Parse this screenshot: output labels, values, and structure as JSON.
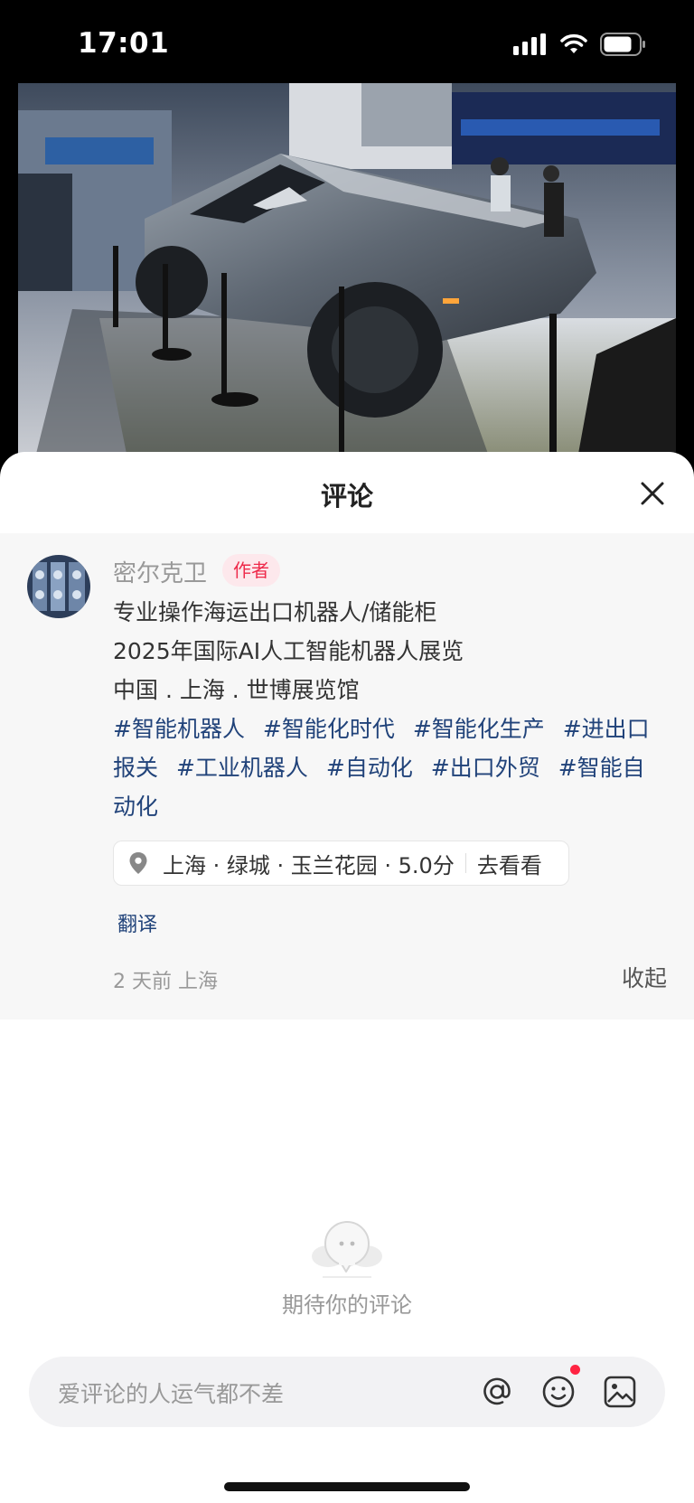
{
  "status_bar": {
    "time": "17:01"
  },
  "sheet": {
    "title": "评论",
    "close_icon": "close-icon"
  },
  "author_post": {
    "author_name": "密尔克卫",
    "author_badge": "作者",
    "lines": [
      "专业操作海运出口机器人/储能柜",
      "2025年国际AI人工智能机器人展览",
      "中国 . 上海 . 世博展览馆"
    ],
    "hashtags": [
      "#智能机器人",
      "#智能化时代",
      "#智能化生产",
      "#进出口报关",
      "#工业机器人",
      "#自动化",
      "#出口外贸",
      "#智能自动化"
    ],
    "location": "上海 · 绿城 · 玉兰花园 · 5.0分",
    "location_action": "去看看",
    "translate": "翻译",
    "meta": "2 天前 上海",
    "collapse": "收起"
  },
  "empty_state": {
    "text": "期待你的评论"
  },
  "input": {
    "placeholder": "爱评论的人运气都不差",
    "icons": [
      "at-icon",
      "emoji-icon",
      "image-icon"
    ]
  },
  "colors": {
    "accent": "#ff2442",
    "link": "#21437a",
    "badge_bg": "#fde8ec"
  }
}
